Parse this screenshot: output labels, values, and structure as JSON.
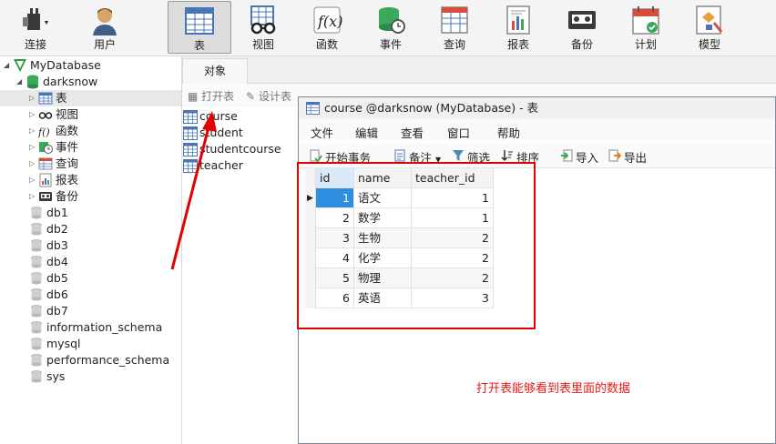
{
  "toolbar": {
    "items": [
      {
        "label": "连接",
        "icon": "plug-icon"
      },
      {
        "label": "用户",
        "icon": "user-icon"
      },
      {
        "label": "表",
        "icon": "table-icon"
      },
      {
        "label": "视图",
        "icon": "view-glasses-icon"
      },
      {
        "label": "函数",
        "icon": "function-icon"
      },
      {
        "label": "事件",
        "icon": "event-clock-icon"
      },
      {
        "label": "查询",
        "icon": "query-icon"
      },
      {
        "label": "报表",
        "icon": "report-icon"
      },
      {
        "label": "备份",
        "icon": "backup-tape-icon"
      },
      {
        "label": "计划",
        "icon": "calendar-icon"
      },
      {
        "label": "模型",
        "icon": "model-icon"
      }
    ],
    "active": "表"
  },
  "tree": {
    "connection": "MyDatabase",
    "database": "darksnow",
    "children": [
      "表",
      "视图",
      "函数",
      "事件",
      "查询",
      "报表",
      "备份"
    ],
    "databases": [
      "db1",
      "db2",
      "db3",
      "db4",
      "db5",
      "db6",
      "db7",
      "information_schema",
      "mysql",
      "performance_schema",
      "sys"
    ]
  },
  "objects": {
    "tab": "对象",
    "open_table": "打开表",
    "design_table": "设计表",
    "tables": [
      "course",
      "student",
      "studentcourse",
      "teacher"
    ]
  },
  "window": {
    "title": "course @darksnow (MyDatabase) - 表",
    "menu": [
      "文件",
      "编辑",
      "查看",
      "窗口",
      "帮助"
    ],
    "toolbar": {
      "begin_transaction": "开始事务",
      "memo": "备注",
      "filter": "筛选",
      "sort": "排序",
      "import": "导入",
      "export": "导出"
    },
    "grid": {
      "columns": [
        "id",
        "name",
        "teacher_id"
      ],
      "rows": [
        [
          "1",
          "语文",
          "1"
        ],
        [
          "2",
          "数学",
          "1"
        ],
        [
          "3",
          "生物",
          "2"
        ],
        [
          "4",
          "化学",
          "2"
        ],
        [
          "5",
          "物理",
          "2"
        ],
        [
          "6",
          "英语",
          "3"
        ]
      ]
    }
  },
  "annotation": {
    "note": "打开表能够看到表里面的数据",
    "color": "#e00000"
  }
}
